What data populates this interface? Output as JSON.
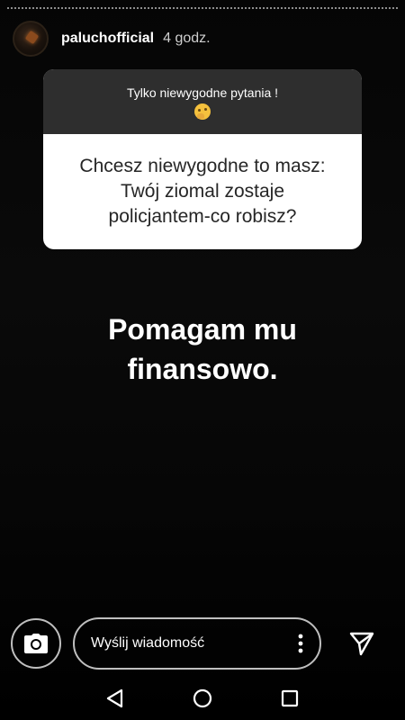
{
  "header": {
    "username": "paluchofficial",
    "timestamp": "4 godz."
  },
  "question_sticker": {
    "prompt": "Tylko niewygodne pytania !",
    "prompt_icon": "thinking-face-emoji",
    "question": "Chcesz niewygodne to masz:\nTwój ziomal zostaje\npolicjantem-co robisz?"
  },
  "answer": {
    "text": "Pomagam mu\nfinansowo."
  },
  "reply_bar": {
    "camera_icon": "camera-icon",
    "placeholder": "Wyślij wiadomość",
    "more_icon": "more-vertical-icon",
    "send_icon": "send-icon"
  },
  "navigation": {
    "back_icon": "back-triangle-icon",
    "home_icon": "home-circle-icon",
    "recents_icon": "recents-square-icon"
  },
  "colors": {
    "background": "#000000",
    "card_header": "#2e2e2e",
    "card_body": "#ffffff",
    "question_text": "#262626"
  }
}
